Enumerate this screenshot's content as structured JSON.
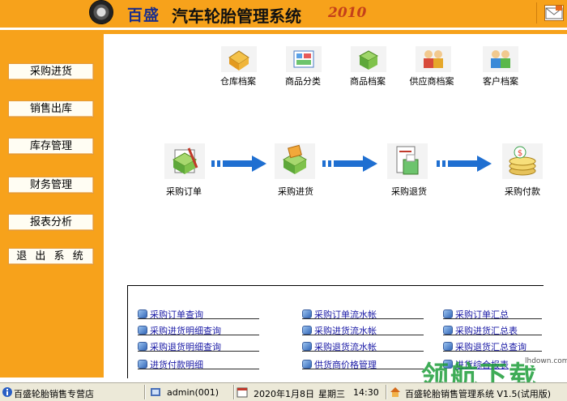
{
  "header": {
    "brand": "百盛",
    "title": "汽车轮胎管理系统",
    "year": "2010"
  },
  "sidebar": {
    "items": [
      {
        "label": "采购进货"
      },
      {
        "label": "销售出库"
      },
      {
        "label": "库存管理"
      },
      {
        "label": "财务管理"
      },
      {
        "label": "报表分析"
      },
      {
        "label": "退 出 系 统"
      }
    ]
  },
  "toolbar": {
    "items": [
      {
        "label": "仓库档案",
        "icon": "warehouse-icon"
      },
      {
        "label": "商品分类",
        "icon": "category-icon"
      },
      {
        "label": "商品档案",
        "icon": "product-icon"
      },
      {
        "label": "供应商档案",
        "icon": "supplier-icon"
      },
      {
        "label": "客户档案",
        "icon": "customer-icon"
      }
    ]
  },
  "flow": {
    "steps": [
      {
        "label": "采购订单",
        "icon": "purchase-order-icon"
      },
      {
        "label": "采购进货",
        "icon": "purchase-receive-icon"
      },
      {
        "label": "采购退货",
        "icon": "purchase-return-icon"
      },
      {
        "label": "采购付款",
        "icon": "purchase-payment-icon"
      }
    ]
  },
  "links": {
    "col1": [
      "采购订单查询",
      "采购进货明细查询",
      "采购退货明细查询",
      "进货付款明细"
    ],
    "col2": [
      "采购订单流水帐",
      "采购进货流水帐",
      "采购退货流水帐",
      "供货商价格管理"
    ],
    "col3": [
      "采购订单汇总",
      "采购进货汇总表",
      "采购退货汇总查询",
      "进货综合报表"
    ]
  },
  "statusbar": {
    "shop": "百盛轮胎销售专营店",
    "user": "admin(001)",
    "date": "2020年1月8日",
    "weekday": "星期三",
    "time": "14:30",
    "product": "百盛轮胎销售管理系统 V1.5(试用版)"
  },
  "watermark": {
    "text": "领航下载",
    "url": "lhdown.com"
  },
  "colors": {
    "accent": "#f7a21b",
    "link": "#1a1aa6",
    "arrow": "#1f6fd1"
  }
}
